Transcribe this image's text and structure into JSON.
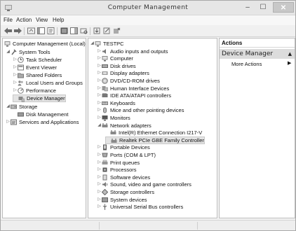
{
  "window": {
    "title": "Computer Management",
    "minimize_glyph": "–",
    "maximize_glyph": "☐",
    "close_glyph": "✕"
  },
  "menu": [
    "File",
    "Action",
    "View",
    "Help"
  ],
  "toolbar_icons": [
    "back-arrow-icon",
    "forward-arrow-icon",
    "up-folder-icon",
    "show-tree-icon",
    "properties-icon",
    "help-icon",
    "show-hide-icon",
    "scan-hardware-icon",
    "update-driver-icon",
    "disable-device-icon",
    "uninstall-device-icon"
  ],
  "left_tree": [
    {
      "label": "Computer Management (Local)",
      "level": 0,
      "arrow": "",
      "icon": "computer-management-icon"
    },
    {
      "label": "System Tools",
      "level": 1,
      "arrow": "◢",
      "icon": "tools-icon"
    },
    {
      "label": "Task Scheduler",
      "level": 2,
      "arrow": "▷",
      "icon": "clock-icon"
    },
    {
      "label": "Event Viewer",
      "level": 2,
      "arrow": "▷",
      "icon": "event-viewer-icon"
    },
    {
      "label": "Shared Folders",
      "level": 2,
      "arrow": "▷",
      "icon": "shared-folder-icon"
    },
    {
      "label": "Local Users and Groups",
      "level": 2,
      "arrow": "▷",
      "icon": "users-icon"
    },
    {
      "label": "Performance",
      "level": 2,
      "arrow": "▷",
      "icon": "performance-icon"
    },
    {
      "label": "Device Manager",
      "level": 2,
      "arrow": "",
      "icon": "device-manager-icon",
      "selected": true
    },
    {
      "label": "Storage",
      "level": 1,
      "arrow": "◢",
      "icon": "storage-icon"
    },
    {
      "label": "Disk Management",
      "level": 2,
      "arrow": "",
      "icon": "disk-management-icon"
    },
    {
      "label": "Services and Applications",
      "level": 1,
      "arrow": "▷",
      "icon": "services-icon"
    }
  ],
  "device_tree": [
    {
      "label": "TESTPC",
      "level": 0,
      "arrow": "◢",
      "icon": "computer-icon"
    },
    {
      "label": "Audio inputs and outputs",
      "level": 1,
      "arrow": "▷",
      "icon": "speaker-icon"
    },
    {
      "label": "Computer",
      "level": 1,
      "arrow": "▷",
      "icon": "computer-icon"
    },
    {
      "label": "Disk drives",
      "level": 1,
      "arrow": "▷",
      "icon": "disk-drive-icon"
    },
    {
      "label": "Display adapters",
      "level": 1,
      "arrow": "▷",
      "icon": "display-adapter-icon"
    },
    {
      "label": "DVD/CD-ROM drives",
      "level": 1,
      "arrow": "▷",
      "icon": "dvd-drive-icon"
    },
    {
      "label": "Human Interface Devices",
      "level": 1,
      "arrow": "▷",
      "icon": "hid-icon"
    },
    {
      "label": "IDE ATA/ATAPI controllers",
      "level": 1,
      "arrow": "▷",
      "icon": "ide-controller-icon"
    },
    {
      "label": "Keyboards",
      "level": 1,
      "arrow": "▷",
      "icon": "keyboard-icon"
    },
    {
      "label": "Mice and other pointing devices",
      "level": 1,
      "arrow": "▷",
      "icon": "mouse-icon"
    },
    {
      "label": "Monitors",
      "level": 1,
      "arrow": "▷",
      "icon": "monitor-icon"
    },
    {
      "label": "Network adapters",
      "level": 1,
      "arrow": "◢",
      "icon": "network-adapter-icon"
    },
    {
      "label": "Intel(R) Ethernet Connection I217-V",
      "level": 2,
      "arrow": "",
      "icon": "network-adapter-icon"
    },
    {
      "label": "Realtek PCIe GBE Family Controller",
      "level": 2,
      "arrow": "",
      "icon": "network-adapter-icon",
      "selected": true
    },
    {
      "label": "Portable Devices",
      "level": 1,
      "arrow": "▷",
      "icon": "portable-device-icon"
    },
    {
      "label": "Ports (COM & LPT)",
      "level": 1,
      "arrow": "▷",
      "icon": "port-icon"
    },
    {
      "label": "Print queues",
      "level": 1,
      "arrow": "▷",
      "icon": "printer-icon"
    },
    {
      "label": "Processors",
      "level": 1,
      "arrow": "▷",
      "icon": "processor-icon"
    },
    {
      "label": "Software devices",
      "level": 1,
      "arrow": "▷",
      "icon": "software-device-icon"
    },
    {
      "label": "Sound, video and game controllers",
      "level": 1,
      "arrow": "▷",
      "icon": "sound-icon"
    },
    {
      "label": "Storage controllers",
      "level": 1,
      "arrow": "▷",
      "icon": "storage-controller-icon"
    },
    {
      "label": "System devices",
      "level": 1,
      "arrow": "▷",
      "icon": "system-device-icon"
    },
    {
      "label": "Universal Serial Bus controllers",
      "level": 1,
      "arrow": "▷",
      "icon": "usb-icon"
    }
  ],
  "actions": {
    "header": "Actions",
    "section": "Device Manager",
    "section_caret": "▲",
    "item": "More Actions",
    "item_arrow": "▶"
  },
  "colors": {
    "selection": "#e4e4e4",
    "section_bg": "#dcdcdc",
    "titlebar": "#e6e6e6"
  }
}
